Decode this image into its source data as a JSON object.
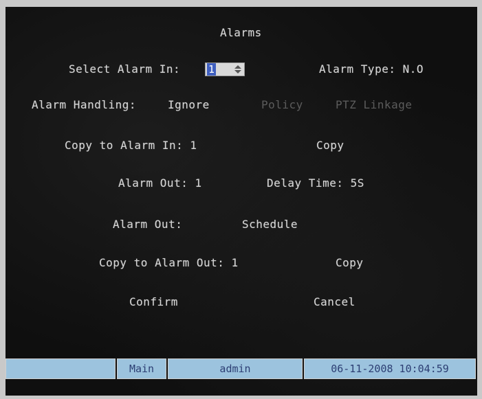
{
  "title": "Alarms",
  "select_alarm_in": {
    "label": "Select Alarm In:",
    "value": "1"
  },
  "alarm_type": "Alarm Type: N.O",
  "alarm_handling": {
    "label": "Alarm Handling:",
    "value": "Ignore",
    "policy": "Policy",
    "ptz_linkage": "PTZ Linkage"
  },
  "copy_to_alarm_in": {
    "label": "Copy to Alarm In: 1",
    "copy": "Copy"
  },
  "alarm_out_row": {
    "alarm_out": "Alarm Out: 1",
    "delay_time": "Delay Time: 5S"
  },
  "alarm_out_schedule": {
    "label": "Alarm Out:",
    "schedule": "Schedule"
  },
  "copy_to_alarm_out": {
    "label": "Copy to Alarm Out: 1",
    "copy": "Copy"
  },
  "buttons": {
    "confirm": "Confirm",
    "cancel": "Cancel"
  },
  "status_bar": {
    "menu": "Main",
    "user": "admin",
    "datetime": "06-11-2008 10:04:59"
  },
  "colors": {
    "screen_bg": "#0f0f0f",
    "text": "#d6d6d6",
    "disabled_text": "#5c5c5c",
    "status_bg": "#9cc3de",
    "status_text": "#2c3e73",
    "selection": "#3f5fbf"
  }
}
